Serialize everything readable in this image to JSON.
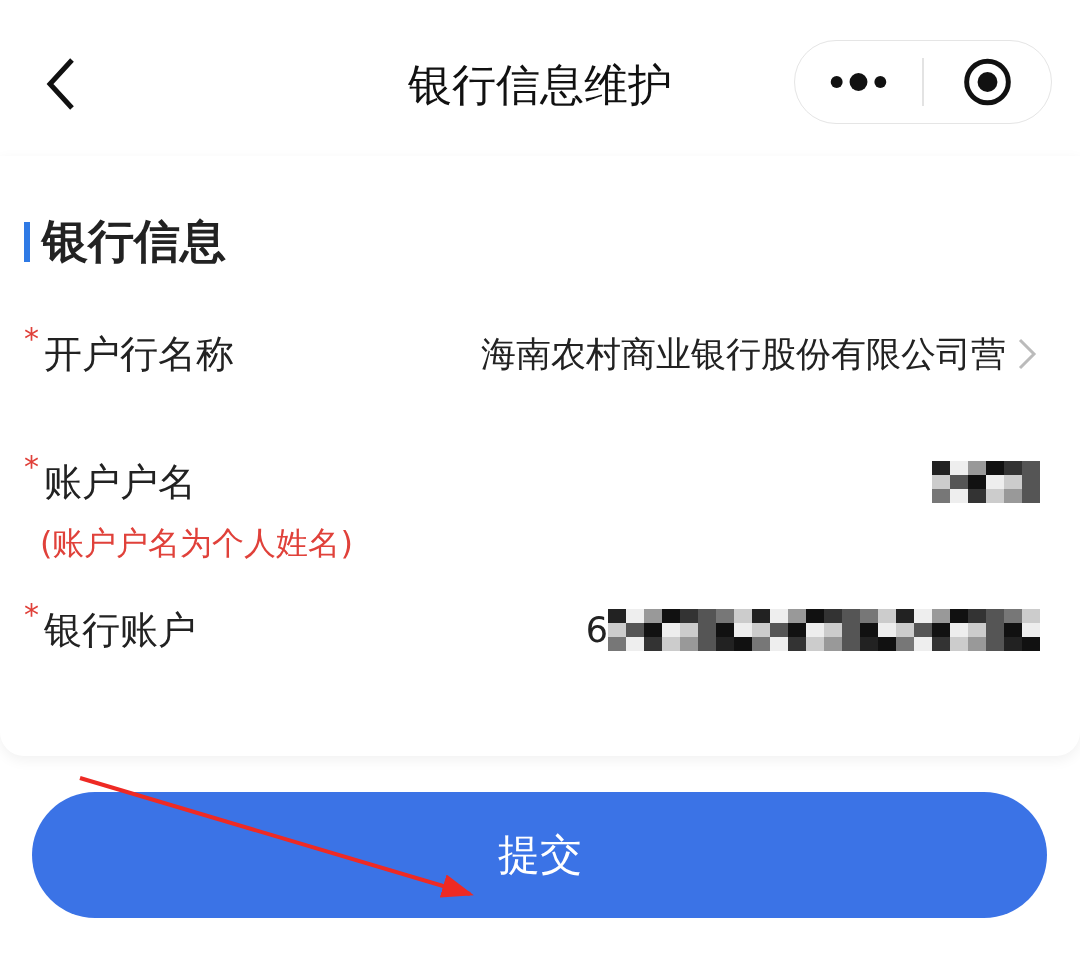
{
  "nav": {
    "title": "银行信息维护"
  },
  "section": {
    "title": "银行信息"
  },
  "fields": [
    {
      "kind": "select",
      "required_mark": "*",
      "label": "开户行名称",
      "value": "海南农村商业银行股份有限公司营"
    },
    {
      "kind": "masked",
      "required_mark": "*",
      "label": "账户户名",
      "hint": "(账户户名为个人姓名)"
    },
    {
      "kind": "masked",
      "required_mark": "*",
      "label": "银行账户",
      "value": "6"
    }
  ],
  "submit": {
    "label": "提交"
  }
}
